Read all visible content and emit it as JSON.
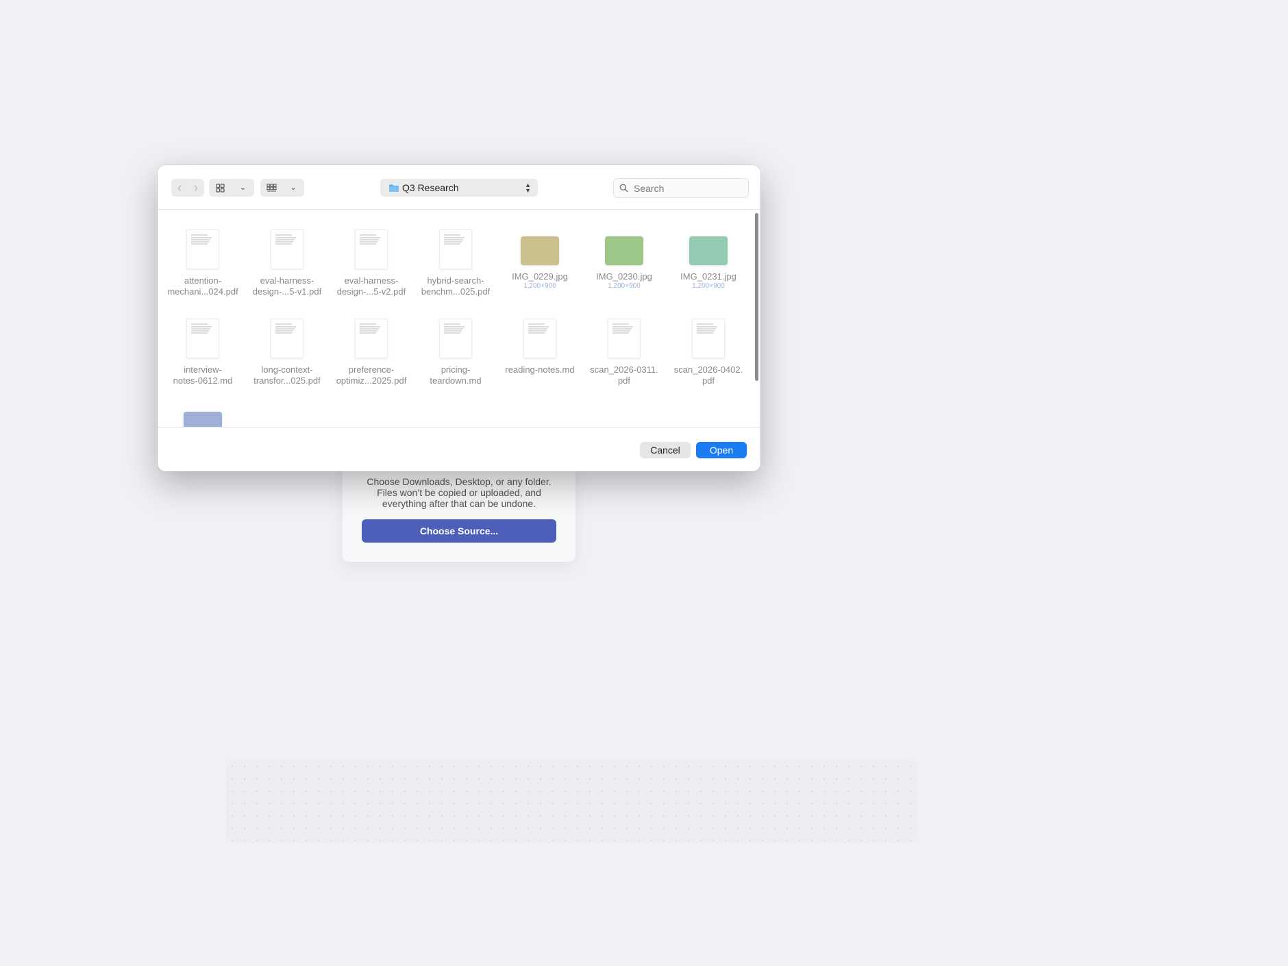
{
  "background_card": {
    "description": "Choose Downloads, Desktop, or any folder.\nFiles won’t be copied or uploaded, and\neverything after that can be undone.",
    "button_label": "Choose Source..."
  },
  "dialog": {
    "location": "Q3 Research",
    "search_placeholder": "Search",
    "cancel_label": "Cancel",
    "open_label": "Open",
    "files": [
      {
        "name": "attention-\nmechani...024.pdf",
        "kind": "doc"
      },
      {
        "name": "eval-harness-\ndesign-...5-v1.pdf",
        "kind": "doc"
      },
      {
        "name": "eval-harness-\ndesign-...5-v2.pdf",
        "kind": "doc"
      },
      {
        "name": "hybrid-search-\nbenchm...025.pdf",
        "kind": "doc"
      },
      {
        "name": "IMG_0229.jpg",
        "kind": "image",
        "dims": "1,200×900",
        "color": "#c9c08e"
      },
      {
        "name": "IMG_0230.jpg",
        "kind": "image",
        "dims": "1,200×900",
        "color": "#9cc789"
      },
      {
        "name": "IMG_0231.jpg",
        "kind": "image",
        "dims": "1,200×900",
        "color": "#92cbb2"
      },
      {
        "name": "interview-\nnotes-0612.md",
        "kind": "doc"
      },
      {
        "name": "long-context-\ntransfor...025.pdf",
        "kind": "doc"
      },
      {
        "name": "preference-\noptimiz...2025.pdf",
        "kind": "doc"
      },
      {
        "name": "pricing-\nteardown.md",
        "kind": "doc"
      },
      {
        "name": "reading-notes.md",
        "kind": "doc"
      },
      {
        "name": "scan_2026-0311.\npdf",
        "kind": "doc"
      },
      {
        "name": "scan_2026-0402.\npdf",
        "kind": "doc"
      },
      {
        "name": "",
        "kind": "image",
        "color": "#9fb0d8"
      }
    ]
  }
}
